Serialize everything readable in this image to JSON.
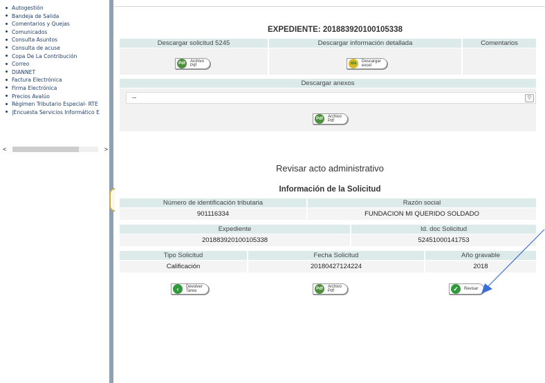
{
  "sidebar": {
    "items": [
      {
        "label": "Autogestión"
      },
      {
        "label": "Bandeja de Salida"
      },
      {
        "label": "Comentarios y Quejas"
      },
      {
        "label": "Comunicados"
      },
      {
        "label": "Consulta Asuntos"
      },
      {
        "label": "Consulta de acuse"
      },
      {
        "label": "Copa De La Contribución"
      },
      {
        "label": "Correo"
      },
      {
        "label": "DIANNET"
      },
      {
        "label": "Factura Electrónica"
      },
      {
        "label": "Firma Electrónica"
      },
      {
        "label": "Precios Avalúo"
      },
      {
        "label": "Régimen Tributario Especial- RTE"
      },
      {
        "label": "|Encuesta Servicios Informático E"
      }
    ],
    "scroll_left": "<",
    "scroll_right": ">"
  },
  "expediente": {
    "title": "EXPEDIENTE: 201883920100105338",
    "col_solicitud": "Descargar solicitud 5245",
    "col_info": "Descargar información detallada",
    "col_comentarios": "Comentarios",
    "btn_archivo_pdf": "Archivo\nPdf",
    "btn_excel": "Descargar\nexcel",
    "excel_icon": "xls",
    "pdf_icon": "Pdf",
    "anexos_header": "Descargar anexos",
    "anexos_selected": "--",
    "dropdown_arrow": "▽"
  },
  "revisar": {
    "title": "Revisar acto administrativo",
    "info_title": "Información de la Solicitud",
    "nit_header": "Número de identificación tributaria",
    "nit_value": "901116334",
    "razon_header": "Razón social",
    "razon_value": "FUNDACION MI QUERIDO SOLDADO",
    "exp_header": "Expediente",
    "exp_value": "201883920100105338",
    "iddoc_header": "Id. doc Solicitud",
    "iddoc_value": "52451000141753",
    "tipo_header": "Tipo Solicitud",
    "tipo_value": "Calificación",
    "fecha_header": "Fecha Solicitud",
    "fecha_value": "20180427124224",
    "anio_header": "Año gravable",
    "anio_value": "2018",
    "btn_devolver": "Devolver\nTarea",
    "btn_pdf": "Archivo\nPdf",
    "btn_revisar": "Revisar",
    "back_icon": "‹",
    "check_icon": "✓"
  },
  "colors": {
    "header_bg": "#dceaea",
    "row_bg": "#f4f4f4",
    "divider": "#8ea1b1",
    "arrow": "#3b6fd8"
  }
}
